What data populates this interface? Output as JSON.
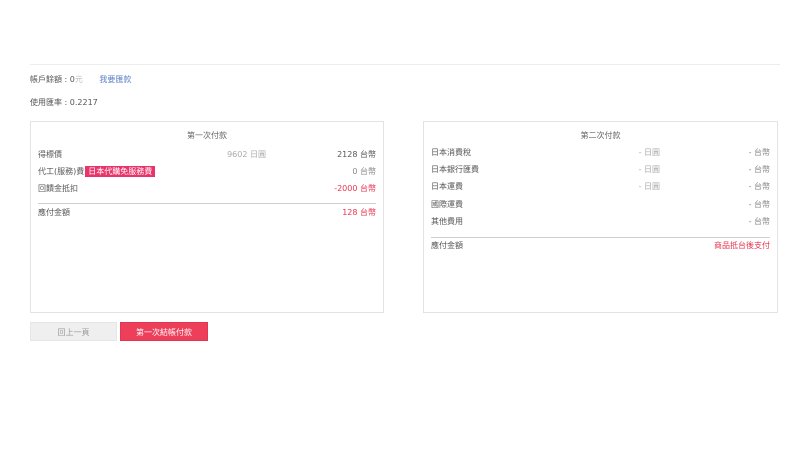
{
  "account": {
    "balance_label": "帳戶餘額 : ",
    "balance_value": "0",
    "balance_unit": "元",
    "remit_link": "我要匯款",
    "rate_text": "使用匯率 : 0.2217"
  },
  "first_payment": {
    "title": "第一次付款",
    "rows": [
      {
        "name": "得標價",
        "yen": "9602 日圓",
        "twd": "2128 台幣"
      },
      {
        "name": "代工(服務)費",
        "badge": "日本代購免服務費",
        "twd": "0 台幣"
      },
      {
        "name": "回饋金抵扣",
        "twd": "-2000 台幣"
      }
    ],
    "total_label": "應付金額",
    "total_value": "128 台幣"
  },
  "second_payment": {
    "title": "第二次付款",
    "rows": [
      {
        "name": "日本消費稅",
        "yen": "- 日圓",
        "twd": "- 台幣"
      },
      {
        "name": "日本銀行匯費",
        "yen": "- 日圓",
        "twd": "- 台幣"
      },
      {
        "name": "日本運費",
        "yen": "- 日圓",
        "twd": "- 台幣"
      },
      {
        "name": "國際運費",
        "twd": "- 台幣"
      },
      {
        "name": "其他費用",
        "twd": "- 台幣"
      }
    ],
    "total_label": "應付金額",
    "total_value": "商品抵台後支付"
  },
  "buttons": {
    "back": "回上一頁",
    "pay": "第一次結帳付款"
  }
}
